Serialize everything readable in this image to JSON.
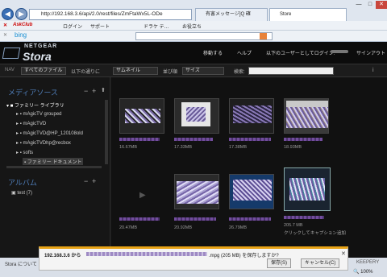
{
  "browser": {
    "url": "http://192.168.3.6/api/2.0/rest/files/ZmFtaWx5L-ODe",
    "tabs": [
      "有害メッセージ]Q 確",
      "Store"
    ],
    "toolbar1": {
      "askclub": "AskClub",
      "login": "ログイン",
      "support": "サポート",
      "dorake": "ドラケ テ…",
      "favorite": "お役立ち"
    },
    "toolbar2": {
      "bing": "bing"
    }
  },
  "app": {
    "logo_top": "NETGEAR",
    "logo_main": "Stora",
    "menu": [
      "移動する",
      "ヘルプ",
      "以下のユーザーとしてログイン:",
      "サインアウト"
    ]
  },
  "filter": {
    "label": "NAV",
    "type_value": "すべてのファイル",
    "order_label": "以下の通りに",
    "view_value": "サムネイル",
    "sort_label": "並び順",
    "sort_value": "サイズ",
    "search_label": "検索:"
  },
  "sidebar": {
    "media_title": "メディアソース",
    "library": "ファミリー ライブラリ",
    "folders": [
      "mAgicTV grouped",
      "mAgicTVD",
      "mAgicTVD@HP_120108old",
      "mAgicTVDhp@recbox",
      "softs",
      "ファミリー ドキュメント"
    ],
    "album_title": "アルバム",
    "albums": [
      "test (7)"
    ]
  },
  "files": [
    {
      "size": "16.67MB"
    },
    {
      "size": "17.33MB"
    },
    {
      "size": "17.38MB"
    },
    {
      "size": "18.93MB"
    },
    {
      "size": "20.47MB"
    },
    {
      "size": "20.92MB"
    },
    {
      "size": "26.79MB"
    },
    {
      "size": "205.7 MB",
      "note": "クリックしてキャプション追加"
    }
  ],
  "footer": {
    "left": "Stora について",
    "right": "KEEPERY"
  },
  "download": {
    "text_pre": "192.168.3.6 から",
    "text_post": ".mpg (205 MB) を保存しますか?",
    "save": "保存(S)",
    "cancel": "キャンセル(C)"
  },
  "status": {
    "zoom": "100%"
  }
}
